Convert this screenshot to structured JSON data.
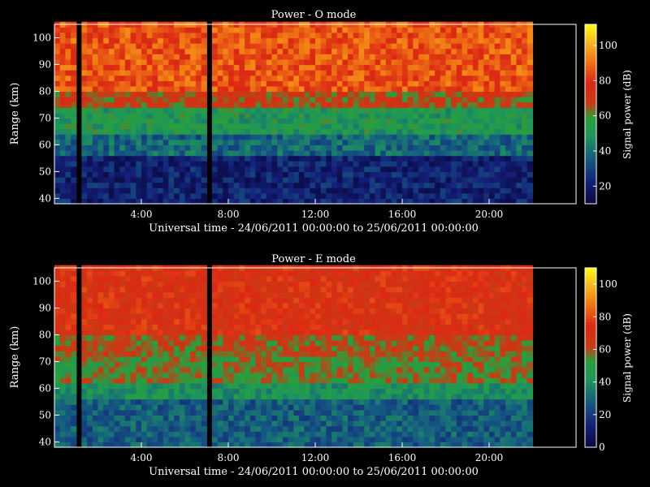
{
  "chart_data": [
    {
      "type": "heatmap",
      "title": "Power - O mode",
      "xlabel": "Universal time - 24/06/2011 00:00:00 to 25/06/2011 00:00:00",
      "ylabel": "Range (km)",
      "colorbar_label": "Signal power (dB)",
      "x_range_hours": [
        0,
        24
      ],
      "x_ticks": [
        4,
        8,
        12,
        16,
        20
      ],
      "x_tick_labels": [
        "4:00",
        "8:00",
        "12:00",
        "16:00",
        "20:00"
      ],
      "y_range_km": [
        38,
        105
      ],
      "y_ticks": [
        40,
        50,
        60,
        70,
        80,
        90,
        100
      ],
      "y_tick_labels": [
        "40",
        "50",
        "60",
        "70",
        "80",
        "90",
        "100"
      ],
      "colorbar_range_db": [
        10,
        112
      ],
      "colorbar_ticks": [
        20,
        40,
        60,
        80,
        100
      ],
      "colorbar_tick_labels": [
        "20",
        "40",
        "60",
        "80",
        "100"
      ],
      "no_data_intervals_hours": [
        [
          1.0,
          1.15
        ],
        [
          3.4,
          3.5
        ],
        [
          6.95,
          7.05
        ],
        [
          17.8,
          18.0
        ],
        [
          21.9,
          24.0
        ]
      ],
      "layers": [
        {
          "range_km": [
            38,
            57
          ],
          "signal_db_approx": 22
        },
        {
          "range_km": [
            57,
            64
          ],
          "signal_db_approx": 38
        },
        {
          "range_km": [
            64,
            74
          ],
          "signal_db_approx": 52
        },
        {
          "range_km": [
            74,
            80
          ],
          "signal_db_approx": 68
        },
        {
          "range_km": [
            80,
            105
          ],
          "signal_db_approx": 86
        }
      ]
    },
    {
      "type": "heatmap",
      "title": "Power - E mode",
      "xlabel": "Universal time - 24/06/2011 00:00:00 to 25/06/2011 00:00:00",
      "ylabel": "Range (km)",
      "colorbar_label": "Signal power (dB)",
      "x_range_hours": [
        0,
        24
      ],
      "x_ticks": [
        4,
        8,
        12,
        16,
        20
      ],
      "x_tick_labels": [
        "4:00",
        "8:00",
        "12:00",
        "16:00",
        "20:00"
      ],
      "y_range_km": [
        38,
        105
      ],
      "y_ticks": [
        40,
        50,
        60,
        70,
        80,
        90,
        100
      ],
      "y_tick_labels": [
        "40",
        "50",
        "60",
        "70",
        "80",
        "90",
        "100"
      ],
      "colorbar_range_db": [
        0,
        110
      ],
      "colorbar_ticks": [
        0,
        20,
        40,
        60,
        80,
        100
      ],
      "colorbar_tick_labels": [
        "0",
        "20",
        "40",
        "60",
        "80",
        "100"
      ],
      "no_data_intervals_hours": [
        [
          1.0,
          1.15
        ],
        [
          3.4,
          3.5
        ],
        [
          6.95,
          7.05
        ],
        [
          17.8,
          18.0
        ],
        [
          21.9,
          24.0
        ]
      ],
      "layers": [
        {
          "range_km": [
            38,
            56
          ],
          "signal_db_approx": 28
        },
        {
          "range_km": [
            56,
            63
          ],
          "signal_db_approx": 42
        },
        {
          "range_km": [
            63,
            72
          ],
          "signal_db_approx": 55
        },
        {
          "range_km": [
            72,
            80
          ],
          "signal_db_approx": 60
        },
        {
          "range_km": [
            80,
            105
          ],
          "signal_db_approx": 72
        }
      ]
    }
  ]
}
